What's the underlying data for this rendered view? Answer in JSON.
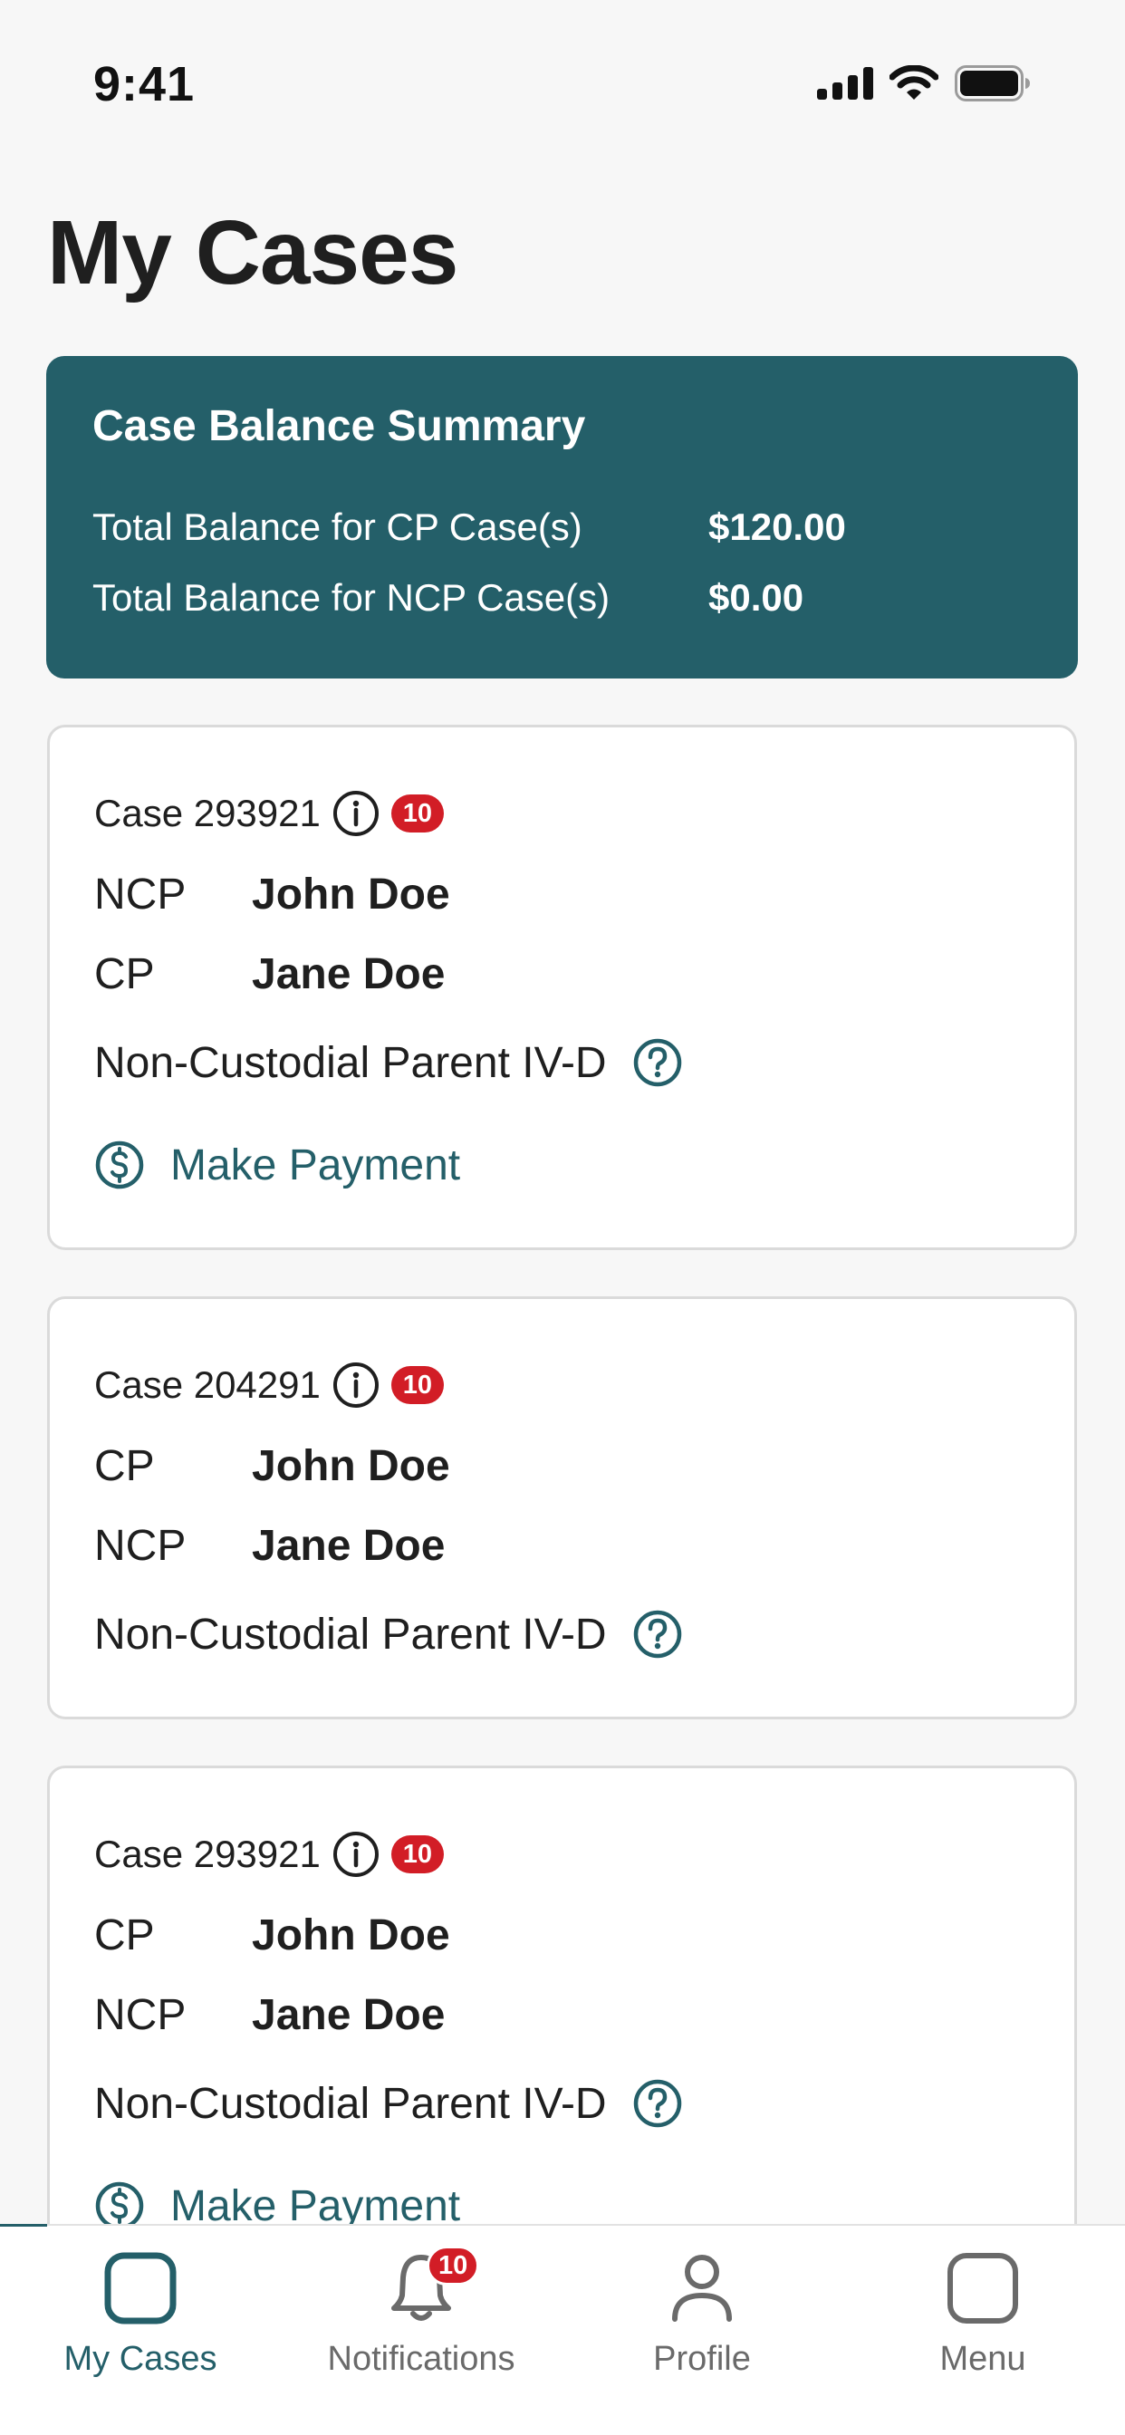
{
  "status_bar": {
    "time": "9:41",
    "icons": [
      "signal-icon",
      "wifi-icon",
      "battery-icon"
    ]
  },
  "page_title": "My Cases",
  "summary": {
    "title": "Case Balance Summary",
    "rows": [
      {
        "label": "Total Balance for CP Case(s)",
        "value": "$120.00"
      },
      {
        "label": "Total Balance for NCP Case(s)",
        "value": "$0.00"
      }
    ]
  },
  "cases": [
    {
      "case_label": "Case 293921",
      "badge": "10",
      "parties": [
        {
          "role": "NCP",
          "name": "John Doe"
        },
        {
          "role": "CP",
          "name": "Jane Doe"
        }
      ],
      "type": "Non-Custodial Parent IV-D",
      "action": "Make Payment"
    },
    {
      "case_label": "Case 204291",
      "badge": "10",
      "parties": [
        {
          "role": "CP",
          "name": "John Doe"
        },
        {
          "role": "NCP",
          "name": "Jane Doe"
        }
      ],
      "type": "Non-Custodial Parent IV-D"
    },
    {
      "case_label": "Case 293921",
      "badge": "10",
      "parties": [
        {
          "role": "CP",
          "name": "John Doe"
        },
        {
          "role": "NCP",
          "name": "Jane Doe"
        }
      ],
      "type": "Non-Custodial Parent IV-D",
      "action": "Make Payment"
    }
  ],
  "tabs": [
    {
      "label": "My Cases",
      "icon": "cases-icon",
      "active": true
    },
    {
      "label": "Notifications",
      "icon": "bell-icon",
      "badge": "10"
    },
    {
      "label": "Profile",
      "icon": "profile-icon"
    },
    {
      "label": "Menu",
      "icon": "menu-icon"
    }
  ],
  "colors": {
    "brand": "#245f69",
    "badge": "#d21d26",
    "background": "#f7f7f7"
  }
}
